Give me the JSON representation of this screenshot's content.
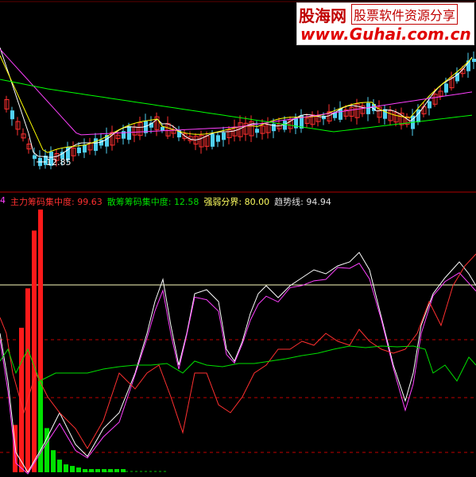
{
  "watermark": {
    "logo": "股海网",
    "slogan": "股票软件资源分享",
    "url": "www.Guhai.com.cn"
  },
  "price_panel": {
    "low_marker_label": "12.85"
  },
  "indicator": {
    "params_label": "4",
    "items": [
      {
        "name": "主力筹码集中度:",
        "value": "99.63",
        "color": "#ff3030"
      },
      {
        "name": "散筹筹码集中度:",
        "value": "12.58",
        "color": "#00e000"
      },
      {
        "name": "强弱分界:",
        "value": "80.00",
        "color": "#ffff60"
      },
      {
        "name": "趋势线:",
        "value": "94.94",
        "color": "#e0e0e0"
      }
    ],
    "colors": {
      "main_line": "#ff3030",
      "retail_line": "#00e000",
      "white_line": "#ffffff",
      "magenta_line": "#ff40ff",
      "divider_line": "#ffffc0"
    }
  },
  "chart_data": [
    {
      "type": "candlestick",
      "title": "",
      "ma_colors": [
        "#ffffff",
        "#ffff00",
        "#ff40ff",
        "#00ff00"
      ],
      "annotation": "12.85"
    },
    {
      "type": "bar",
      "title": "",
      "red_bars": [
        18,
        55,
        70,
        92,
        100
      ],
      "green_bars": [
        58,
        28,
        14,
        8,
        5,
        4,
        3,
        2,
        2,
        2,
        2,
        2,
        2,
        2
      ],
      "threshold": 80
    }
  ]
}
